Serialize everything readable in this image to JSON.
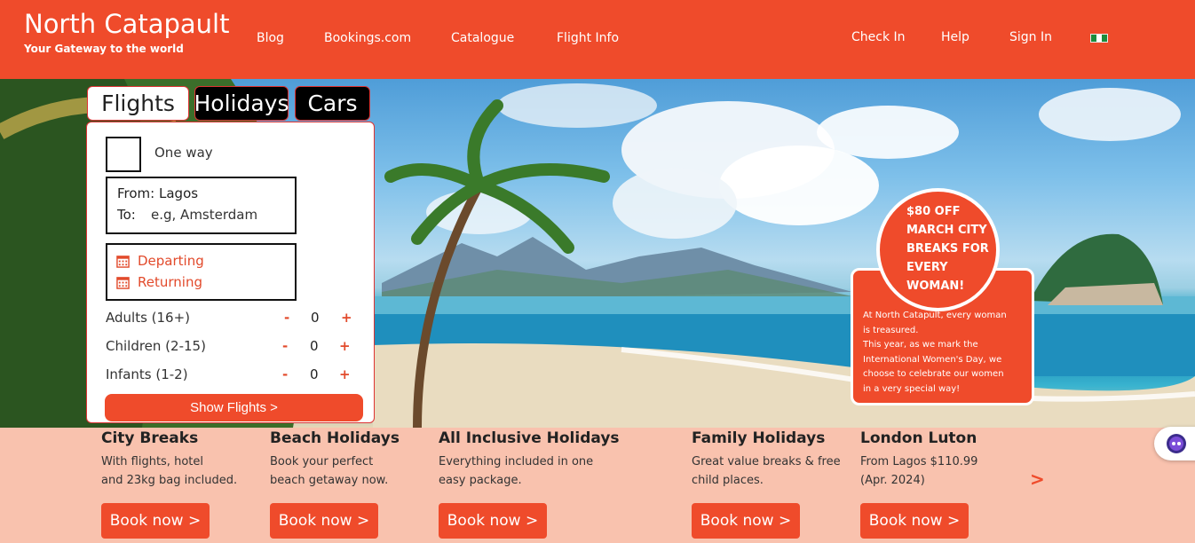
{
  "header": {
    "brand": "North Catapault",
    "tagline": "Your Gateway to the world",
    "nav": [
      "Blog",
      "Bookings.com",
      "Catalogue",
      "Flight Info"
    ],
    "right_nav": [
      "Check In",
      "Help",
      "Sign In"
    ],
    "flag_icon": "nigeria-flag-icon",
    "colors": {
      "brand": "#ef4b2b"
    }
  },
  "search": {
    "tabs": [
      "Flights",
      "Holidays",
      "Cars"
    ],
    "one_way_label": "One way",
    "from_label": "From:",
    "from_value": "Lagos",
    "to_label": "To:",
    "to_placeholder": "e.g, Amsterdam",
    "departing_label": "Departing",
    "returning_label": "Returning",
    "passengers": [
      {
        "label": "Adults (16+)",
        "minus": "-",
        "value": "0",
        "plus": "+"
      },
      {
        "label": "Children (2-15)",
        "minus": "-",
        "value": "0",
        "plus": "+"
      },
      {
        "label": "Infants (1-2)",
        "minus": "-",
        "value": "0",
        "plus": "+"
      }
    ],
    "submit_label": "Show Flights >"
  },
  "promo": {
    "headline": "$80 OFF MARCH CITY BREAKS FOR EVERY WOMAN!",
    "body_line1": "At North Catapult, every woman is treasured.",
    "body_line2": "This year, as we mark the International Women's Day, we choose to celebrate our women in a very special way!"
  },
  "deals": [
    {
      "title": "City Breaks",
      "line1": "With flights, hotel",
      "line2": "and 23kg bag included.",
      "button": "Book now >"
    },
    {
      "title": "Beach Holidays",
      "line1": "Book your perfect",
      "line2": "beach getaway now.",
      "button": "Book now >"
    },
    {
      "title": "All Inclusive Holidays",
      "line1": "Everything included in one",
      "line2": "easy package.",
      "button": "Book now >"
    },
    {
      "title": "Family Holidays",
      "line1": "Great value breaks & free",
      "line2": "child places.",
      "button": "Book now >"
    },
    {
      "title": "London Luton",
      "line1": "From Lagos $110.99",
      "line2": "(Apr. 2024)",
      "button": "Book now >"
    }
  ],
  "carousel_next": ">"
}
